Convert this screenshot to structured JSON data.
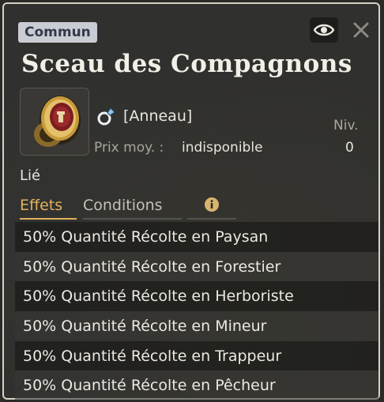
{
  "tooltip": {
    "rarity": "Commun",
    "name": "Sceau des Compagnons",
    "item_type": "[Anneau]",
    "price_label": "Prix moy. :",
    "price_value": "indisponible",
    "level_label": "Niv.",
    "level_value": "0",
    "bound_label": "Lié",
    "tabs": [
      "Effets",
      "Conditions"
    ],
    "active_tab": "Effets",
    "effects": [
      "50% Quantité Récolte en Paysan",
      "50% Quantité Récolte en Forestier",
      "50% Quantité Récolte en Herboriste",
      "50% Quantité Récolte en Mineur",
      "50% Quantité Récolte en Trappeur",
      "50% Quantité Récolte en Pêcheur"
    ]
  },
  "colors": {
    "rarity_badge_bg": "#c9ccd3",
    "active_tab": "#e1b15e",
    "text": "#ece9e1",
    "muted_text": "#a9a69e"
  },
  "icons": {
    "eye": "eye-icon",
    "close": "close-icon",
    "item": "ring-item-icon",
    "type": "ring-icon",
    "info": "info-icon"
  }
}
